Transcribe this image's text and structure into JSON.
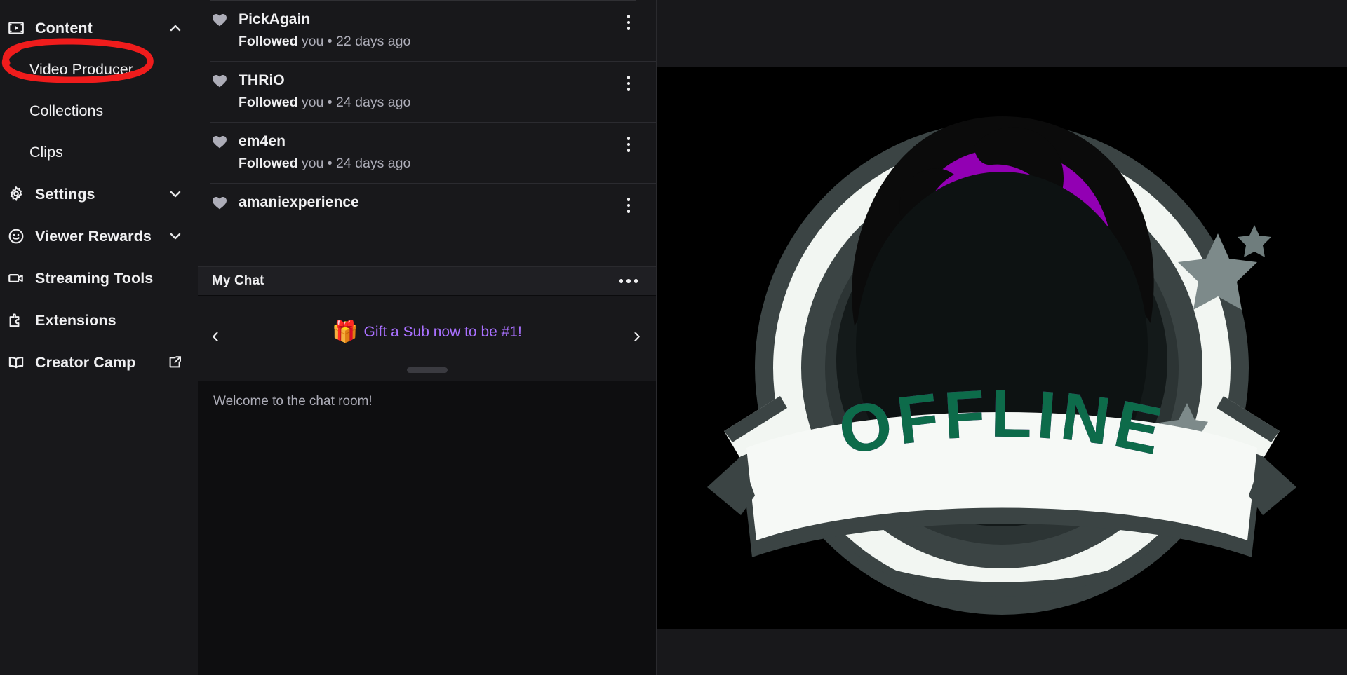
{
  "sidebar": {
    "sections": [
      {
        "id": "content",
        "label": "Content",
        "icon": "content-film-icon",
        "chevron": "chevron-up-icon",
        "expanded": true,
        "children": [
          {
            "id": "video-producer",
            "label": "Video Producer",
            "highlighted": true
          },
          {
            "id": "collections",
            "label": "Collections",
            "highlighted": false
          },
          {
            "id": "clips",
            "label": "Clips",
            "highlighted": false
          }
        ]
      },
      {
        "id": "settings",
        "label": "Settings",
        "icon": "gear-icon",
        "chevron": "chevron-down-icon",
        "expanded": false,
        "children": []
      },
      {
        "id": "viewer-rewards",
        "label": "Viewer Rewards",
        "icon": "smiley-face-icon",
        "chevron": "chevron-down-icon",
        "expanded": false,
        "children": []
      },
      {
        "id": "streaming-tools",
        "label": "Streaming Tools",
        "icon": "video-camera-icon",
        "chevron": "",
        "expanded": false,
        "children": []
      },
      {
        "id": "extensions",
        "label": "Extensions",
        "icon": "puzzle-piece-icon",
        "chevron": "",
        "expanded": false,
        "children": []
      },
      {
        "id": "creator-camp",
        "label": "Creator Camp",
        "icon": "open-book-icon",
        "chevron": "",
        "external": true,
        "external_icon": "external-link-icon",
        "children": []
      }
    ]
  },
  "activity_feed": {
    "items": [
      {
        "icon": "heart-icon",
        "username": "PickAgain",
        "action": "Followed",
        "action_tail": "you",
        "separator": "•",
        "time": "22 days ago",
        "menu_icon": "kebab-menu-icon"
      },
      {
        "icon": "heart-icon",
        "username": "THRiO",
        "action": "Followed",
        "action_tail": "you",
        "separator": "•",
        "time": "24 days ago",
        "menu_icon": "kebab-menu-icon"
      },
      {
        "icon": "heart-icon",
        "username": "em4en",
        "action": "Followed",
        "action_tail": "you",
        "separator": "•",
        "time": "24 days ago",
        "menu_icon": "kebab-menu-icon"
      },
      {
        "icon": "heart-icon",
        "username": "amaniexperience",
        "action": "",
        "action_tail": "",
        "separator": "",
        "time": "",
        "menu_icon": "kebab-menu-icon"
      }
    ]
  },
  "chat": {
    "header_title": "My Chat",
    "header_menu_icon": "ellipsis-horizontal-icon",
    "promo": {
      "gift_icon": "gift-box-icon",
      "gift_glyph": "🎁",
      "text": "Gift a Sub now to be #1!",
      "text_color": "#a970ff",
      "prev_icon": "chevron-left-icon",
      "prev_glyph": "‹",
      "next_icon": "chevron-right-icon",
      "next_glyph": "›"
    },
    "welcome_message": "Welcome to the chat room!"
  },
  "stream": {
    "offline_banner_text": "OFFLINE",
    "offline_text_color": "#0d6b4a",
    "offline_shadow_color": "#8a12a8",
    "accent_purple": "#9200b3",
    "background": "#000000"
  },
  "annotation": {
    "shape": "hand-drawn-ellipse",
    "color": "#ef1c1c",
    "target": "Video Producer"
  },
  "colors": {
    "panel": "#18181b",
    "page": "#0e0e10",
    "text_primary": "#efeff1",
    "text_secondary": "#adadb8",
    "accent": "#a970ff"
  }
}
